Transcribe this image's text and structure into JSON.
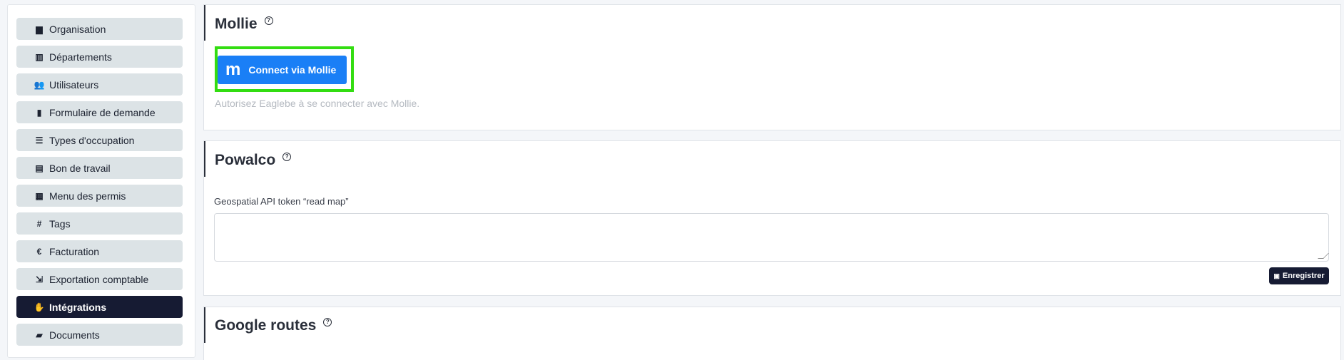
{
  "sidebar": {
    "items": [
      {
        "label": "Organisation",
        "icon": "building-icon",
        "glyph": "▆"
      },
      {
        "label": "Départements",
        "icon": "columns-icon",
        "glyph": "▥"
      },
      {
        "label": "Utilisateurs",
        "icon": "users-icon",
        "glyph": "👥"
      },
      {
        "label": "Formulaire de demande",
        "icon": "clipboard-icon",
        "glyph": "▮"
      },
      {
        "label": "Types d'occupation",
        "icon": "signpost-icon",
        "glyph": "☰"
      },
      {
        "label": "Bon de travail",
        "icon": "file-icon",
        "glyph": "▤"
      },
      {
        "label": "Menu des permis",
        "icon": "table-icon",
        "glyph": "▦"
      },
      {
        "label": "Tags",
        "icon": "hashtag-icon",
        "glyph": "#"
      },
      {
        "label": "Facturation",
        "icon": "euro-icon",
        "glyph": "€"
      },
      {
        "label": "Exportation comptable",
        "icon": "file-export-icon",
        "glyph": "⇲"
      },
      {
        "label": "Intégrations",
        "icon": "handshake-icon",
        "glyph": "✋",
        "active": true
      },
      {
        "label": "Documents",
        "icon": "folder-open-icon",
        "glyph": "▰"
      }
    ]
  },
  "mollie": {
    "title": "Mollie",
    "button_logo": "m",
    "button_label": "Connect via Mollie",
    "hint": "Autorisez Eaglebe à se connecter avec Mollie."
  },
  "powalco": {
    "title": "Powalco",
    "field_label": "Geospatial API token “read map”",
    "field_value": "",
    "save_label": "Enregistrer"
  },
  "google_routes": {
    "title": "Google routes"
  },
  "colors": {
    "primary": "#161b33",
    "mollie_blue": "#1a7ff6",
    "highlight": "#33dd11",
    "nav_bg": "#dce3e6"
  }
}
